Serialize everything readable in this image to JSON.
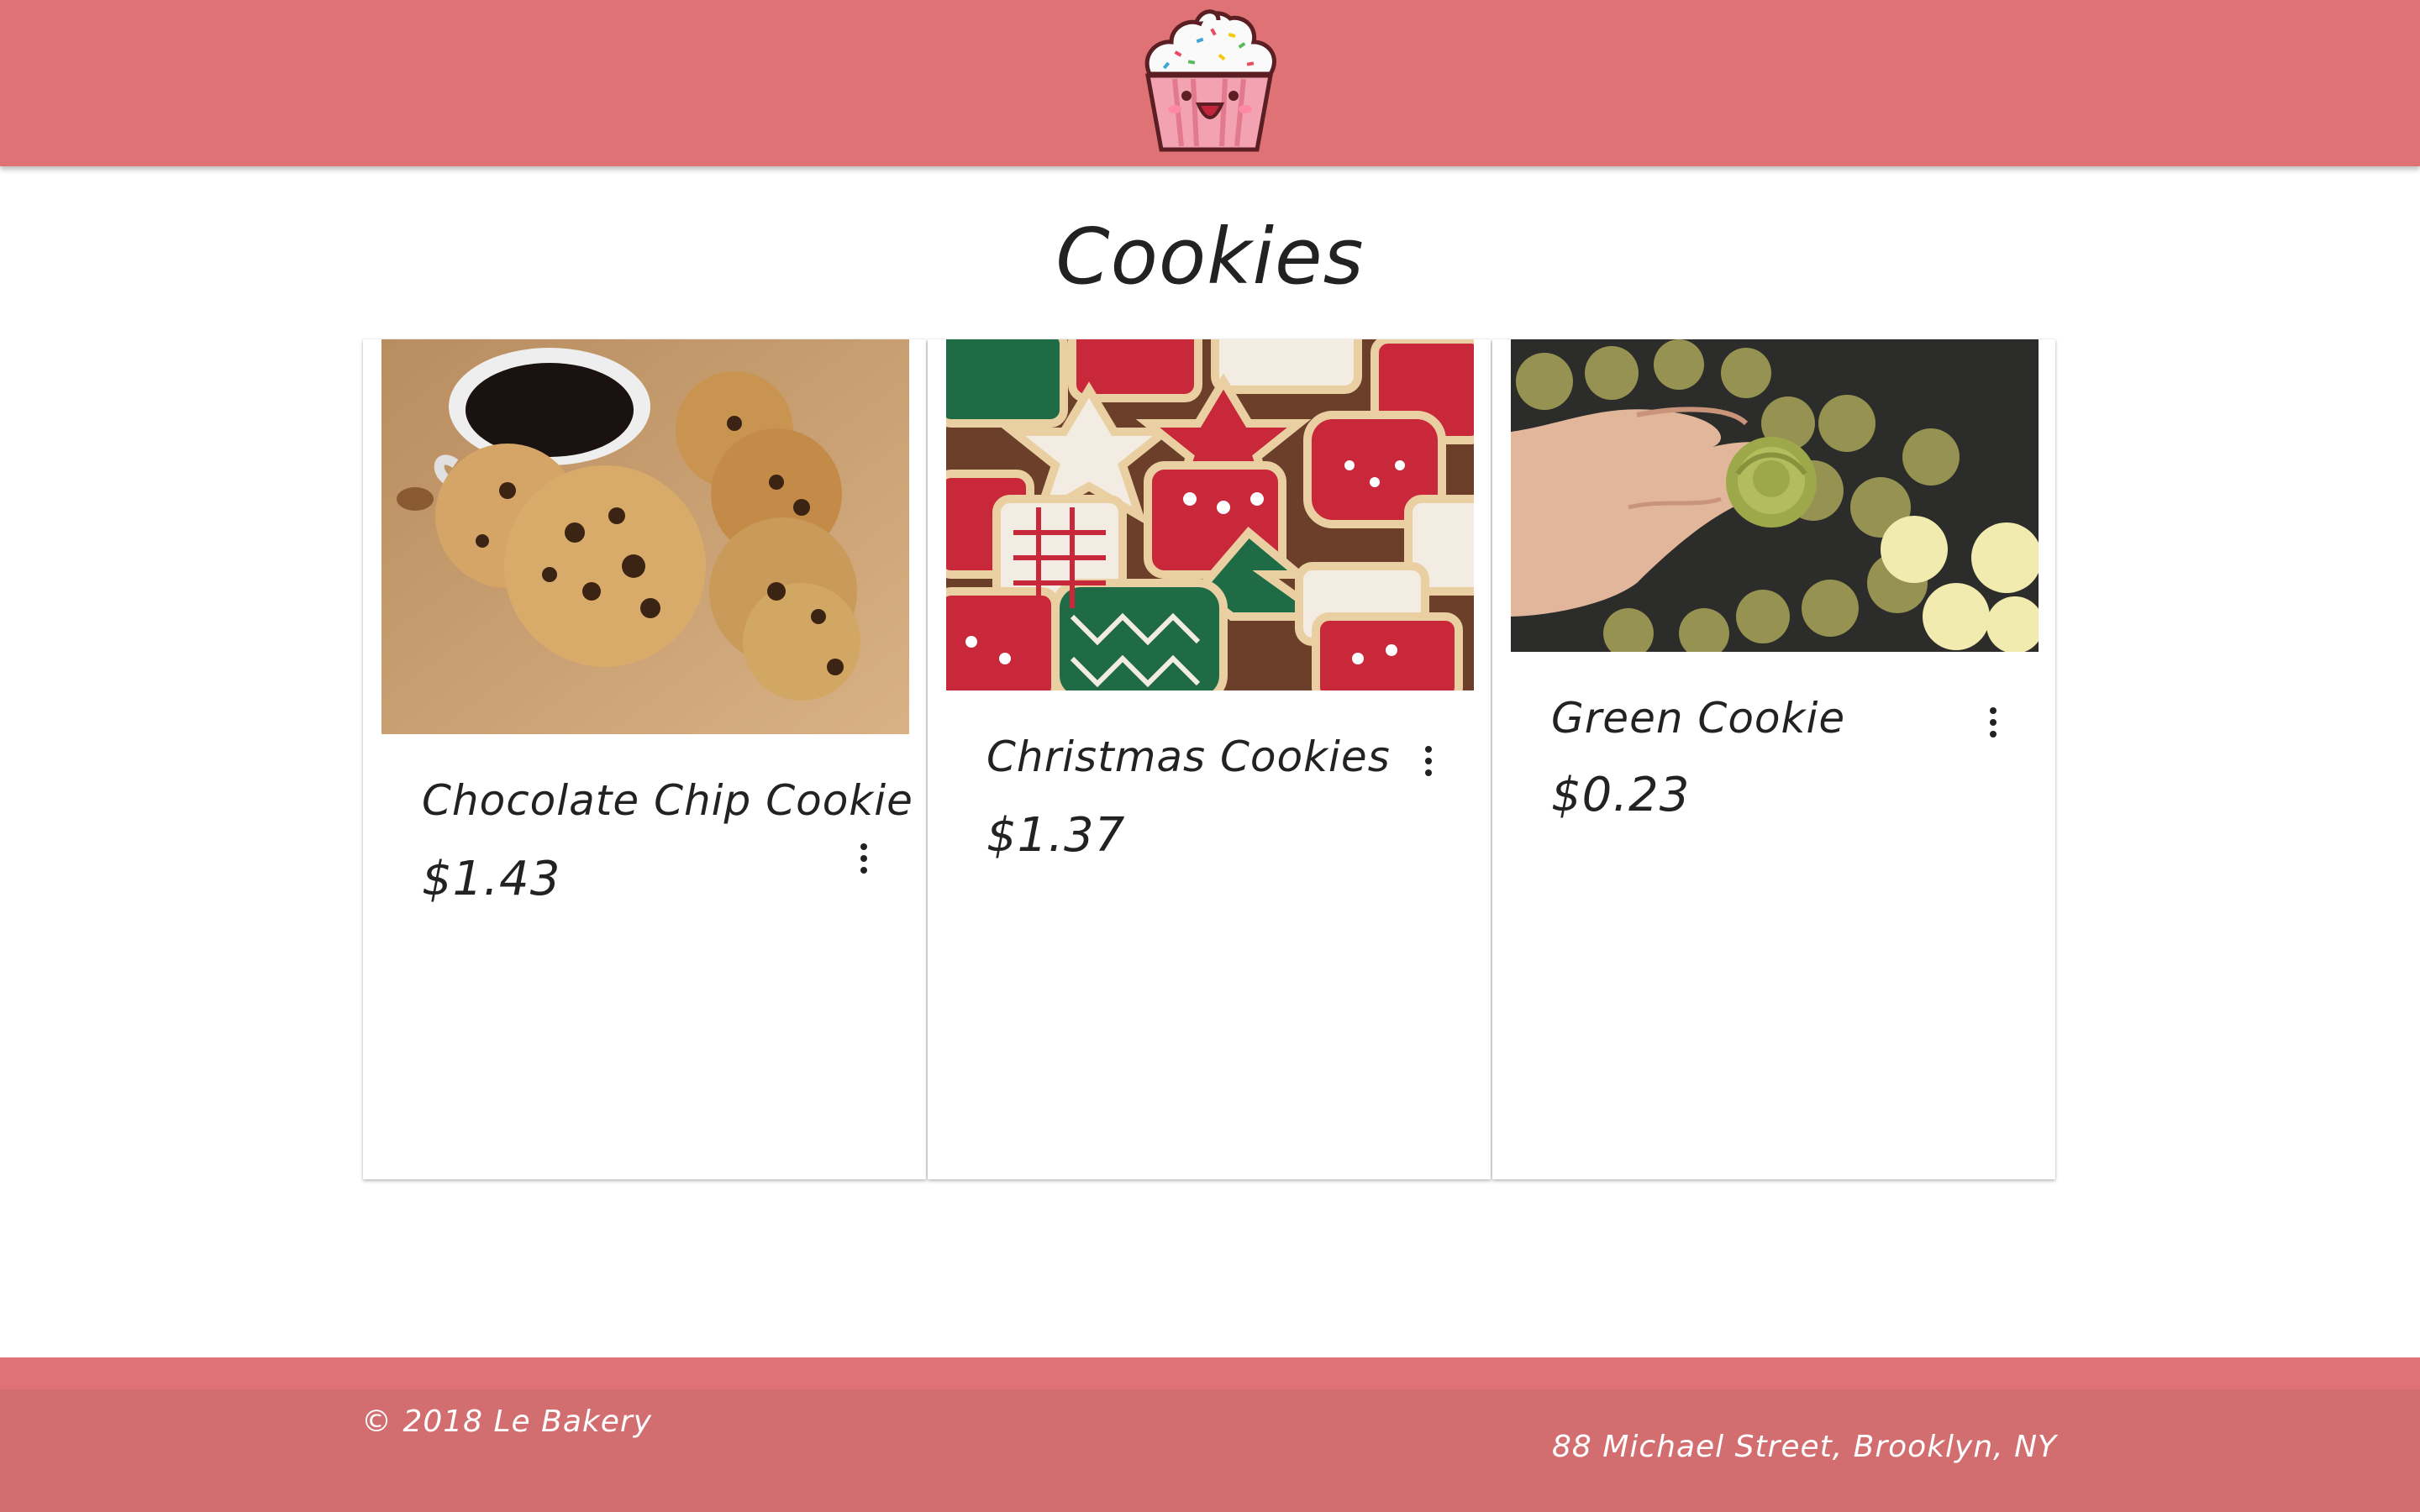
{
  "header": {
    "logo": "cupcake-logo",
    "background": "#de7275"
  },
  "page": {
    "title": "Cookies"
  },
  "products": [
    {
      "name": "Chocolate Chip Cookie",
      "price": "$1.43",
      "image": "chocolate-chip-cookies-with-coffee"
    },
    {
      "name": "Christmas Cookies",
      "price": "$1.37",
      "image": "decorated-christmas-cookies"
    },
    {
      "name": "Green Cookie",
      "price": "$0.23",
      "image": "green-cookie-in-hand"
    }
  ],
  "footer": {
    "copyright": "© 2018 Le Bakery",
    "address": "88 Michael Street, Brooklyn, NY",
    "background": "#d36e70"
  },
  "icons": {
    "card_menu": "more-vert-icon"
  }
}
